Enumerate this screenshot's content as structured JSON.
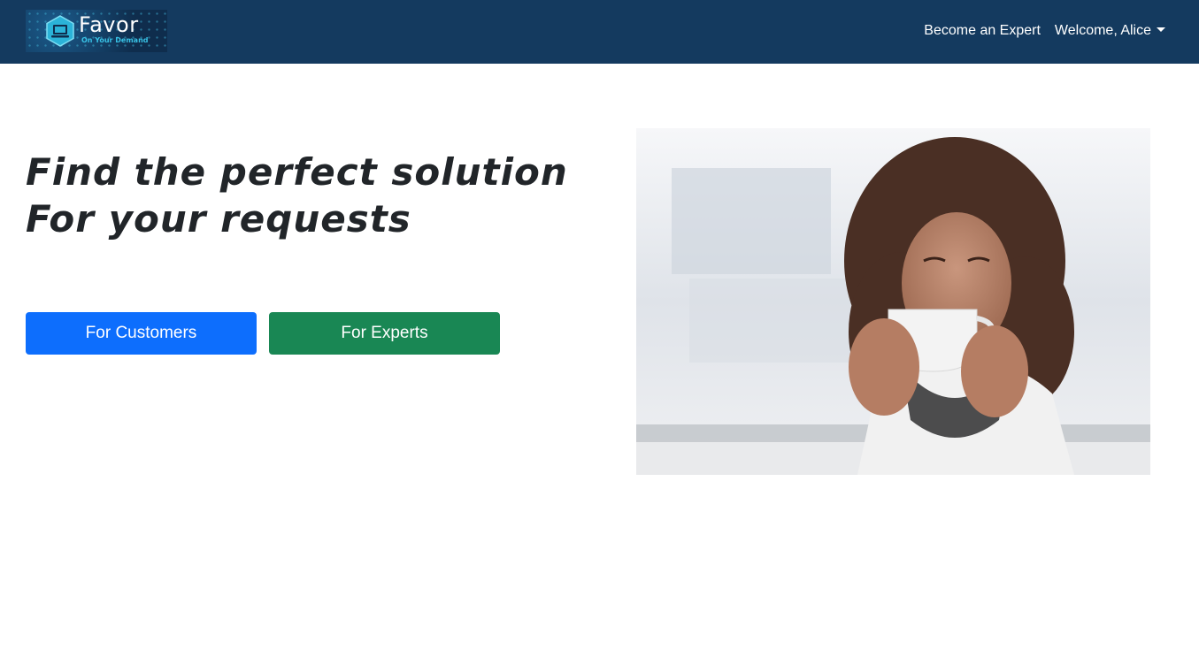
{
  "navbar": {
    "logo": {
      "brand": "Favor",
      "tagline": "On Your Demand",
      "icon": "laptop-hexagon-icon"
    },
    "links": {
      "become_expert": "Become an Expert",
      "welcome": "Welcome, Alice"
    },
    "colors": {
      "background": "#143a5f"
    }
  },
  "hero": {
    "headline_line1": "Find the perfect solution",
    "headline_line2": "For your requests",
    "buttons": {
      "customers": "For Customers",
      "experts": "For Experts"
    },
    "colors": {
      "customers": "#0d6efd",
      "experts": "#198754"
    },
    "image": "woman-drinking-coffee-photo"
  }
}
